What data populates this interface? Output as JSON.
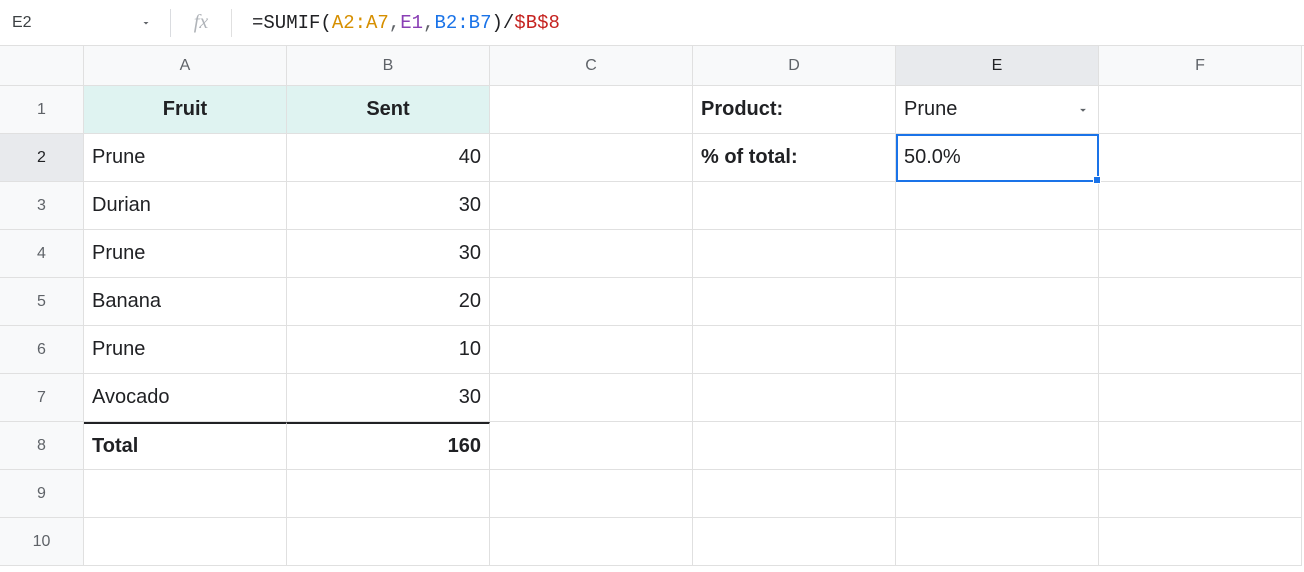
{
  "formulaBar": {
    "nameBox": "E2",
    "fxLabel": "fx",
    "formula": {
      "eq": "=",
      "fn": "SUMIF",
      "lparen": "(",
      "arg1": "A2:A7",
      "comma1": ",",
      "arg2": "E1",
      "comma2": ",",
      "arg3": "B2:B7",
      "rparen": ")",
      "div": "/",
      "abs": "$B$8"
    }
  },
  "columns": [
    "A",
    "B",
    "C",
    "D",
    "E",
    "F"
  ],
  "rowNumbers": [
    "1",
    "2",
    "3",
    "4",
    "5",
    "6",
    "7",
    "8",
    "9",
    "10"
  ],
  "headers": {
    "fruit": "Fruit",
    "sent": "Sent"
  },
  "data": {
    "A2": "Prune",
    "B2": "40",
    "A3": "Durian",
    "B3": "30",
    "A4": "Prune",
    "B4": "30",
    "A5": "Banana",
    "B5": "20",
    "A6": "Prune",
    "B6": "10",
    "A7": "Avocado",
    "B7": "30",
    "A8": "Total",
    "B8": "160"
  },
  "labels": {
    "product": "Product:",
    "pctTotal": "% of total:"
  },
  "values": {
    "productSelected": "Prune",
    "pctTotal": "50.0%"
  },
  "activeCell": "E2"
}
